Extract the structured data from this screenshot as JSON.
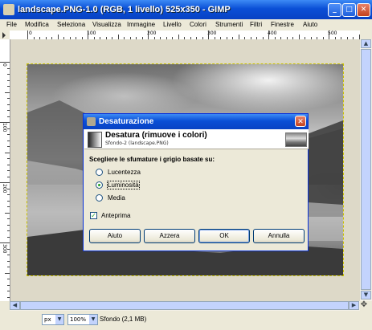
{
  "window": {
    "title": "landscape.PNG-1.0 (RGB, 1 livello) 525x350 - GIMP",
    "controls": {
      "minimize": "_",
      "maximize": "□",
      "close": "✕"
    }
  },
  "menubar": {
    "items": [
      "File",
      "Modifica",
      "Seleziona",
      "Visualizza",
      "Immagine",
      "Livello",
      "Colori",
      "Strumenti",
      "Filtri",
      "Finestre",
      "Aiuto"
    ]
  },
  "ruler": {
    "top_labels": [
      "0",
      "100",
      "200",
      "300",
      "400",
      "500"
    ],
    "left_labels": [
      "0",
      "100",
      "200",
      "300"
    ]
  },
  "statusbar": {
    "unit": "px",
    "zoom": "100%",
    "text": "Sfondo (2,1 MB)"
  },
  "dialog": {
    "title": "Desaturazione",
    "header_title": "Desatura (rimuove i colori)",
    "header_subtitle": "Sfondo-2 (landscape.PNG)",
    "prompt": "Scegliere le sfumature i grigio basate su:",
    "options": [
      {
        "label": "Lucentezza",
        "selected": false
      },
      {
        "label": "Luminosità",
        "selected": true
      },
      {
        "label": "Media",
        "selected": false
      }
    ],
    "preview_label": "Anteprima",
    "preview_checked": true,
    "buttons": {
      "help": "Aiuto",
      "reset": "Azzera",
      "ok": "OK",
      "cancel": "Annulla"
    }
  },
  "colors": {
    "titlebar": "#0a4fd6",
    "dialog_border": "#0831d9",
    "radio_dot": "#21a121"
  }
}
